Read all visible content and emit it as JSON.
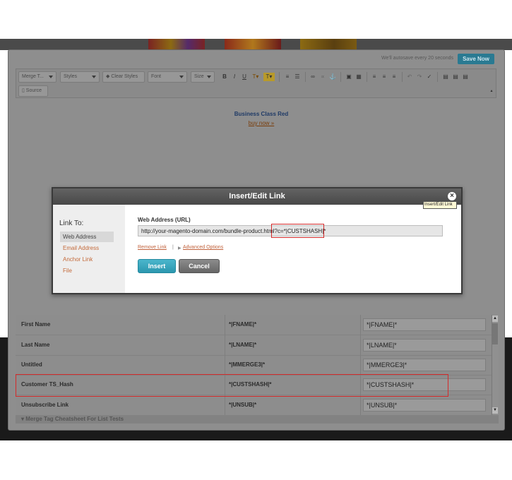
{
  "editor": {
    "autosave_text": "We'll autosave every 20 seconds",
    "save_button": "Save Now",
    "toolbar": {
      "merge_tags": "Merge T...",
      "styles": "Styles",
      "clear_styles": "Clear Styles",
      "font": "Font",
      "size": "Size",
      "source": "Source"
    },
    "content": {
      "title": "Business Class Red",
      "link": "buy now »"
    }
  },
  "merge_table": {
    "rows": [
      {
        "name": "First Name",
        "tag": "*|FNAME|*",
        "value": "*|FNAME|*"
      },
      {
        "name": "Last Name",
        "tag": "*|LNAME|*",
        "value": "*|LNAME|*"
      },
      {
        "name": "Untitled",
        "tag": "*|MMERGE3|*",
        "value": "*|MMERGE3|*"
      },
      {
        "name": "Customer TS_Hash",
        "tag": "*|CUSTSHASH|*",
        "value": "*|CUSTSHASH|*"
      },
      {
        "name": "Unsubscribe Link",
        "tag": "*|UNSUB|*",
        "value": "*|UNSUB|*"
      }
    ],
    "footer": "Merge Tag Cheatsheet For List Tests"
  },
  "dialog": {
    "title": "Insert/Edit Link",
    "tooltip": "Insert/Edit Link",
    "link_to_label": "Link To:",
    "link_types": [
      "Web Address",
      "Email Address",
      "Anchor Link",
      "File"
    ],
    "selected_link_type": "Web Address",
    "url_label": "Web Address (URL)",
    "url_value": "http://your-magento-domain.com/bundle-product.html?c=*|CUSTSHASH|*",
    "remove_link": "Remove Link",
    "separator": "|",
    "advanced_options": "Advanced Options",
    "insert_button": "Insert",
    "cancel_button": "Cancel"
  },
  "colors": {
    "accent": "#2b97af",
    "highlight": "#d42a2a",
    "link": "#c0603a"
  }
}
